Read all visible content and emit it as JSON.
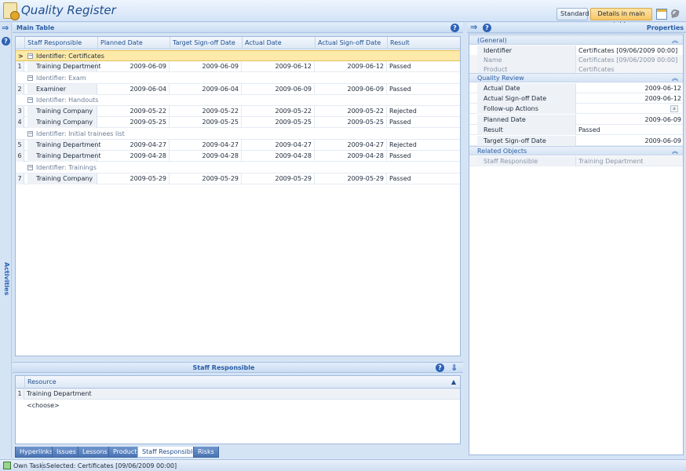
{
  "app": {
    "title": "Quality Register"
  },
  "toolbar": {
    "standard_label": "Standard",
    "details_label": "Details in main table"
  },
  "left_strip": {
    "label": "Activities"
  },
  "main": {
    "title": "Main Table",
    "columns": [
      "Staff Responsible",
      "Planned Date",
      "Target Sign-off Date",
      "Actual Date",
      "Actual Sign-off Date",
      "Result"
    ],
    "groups": [
      {
        "label": "Identifier: Certificates",
        "selected": true,
        "rows": [
          {
            "num": "1",
            "staff": "Training Department",
            "planned": "2009-06-09",
            "target": "2009-06-09",
            "actual": "2009-06-12",
            "actual_signoff": "2009-06-12",
            "result": "Passed"
          }
        ]
      },
      {
        "label": "Identifier: Exam",
        "rows": [
          {
            "num": "2",
            "staff": "Examiner",
            "planned": "2009-06-04",
            "target": "2009-06-04",
            "actual": "2009-06-09",
            "actual_signoff": "2009-06-09",
            "result": "Passed"
          }
        ]
      },
      {
        "label": "Identifier: Handouts",
        "rows": [
          {
            "num": "3",
            "staff": "Training Company",
            "planned": "2009-05-22",
            "target": "2009-05-22",
            "actual": "2009-05-22",
            "actual_signoff": "2009-05-22",
            "result": "Rejected"
          },
          {
            "num": "4",
            "staff": "Training Company",
            "planned": "2009-05-25",
            "target": "2009-05-25",
            "actual": "2009-05-25",
            "actual_signoff": "2009-05-25",
            "result": "Passed"
          }
        ]
      },
      {
        "label": "Identifier: Initial trainees list",
        "rows": [
          {
            "num": "5",
            "staff": "Training Department",
            "planned": "2009-04-27",
            "target": "2009-04-27",
            "actual": "2009-04-27",
            "actual_signoff": "2009-04-27",
            "result": "Rejected"
          },
          {
            "num": "6",
            "staff": "Training Department",
            "planned": "2009-04-28",
            "target": "2009-04-28",
            "actual": "2009-04-28",
            "actual_signoff": "2009-04-28",
            "result": "Passed"
          }
        ]
      },
      {
        "label": "Identifier: Trainings",
        "rows": [
          {
            "num": "7",
            "staff": "Training Company",
            "planned": "2009-05-29",
            "target": "2009-05-29",
            "actual": "2009-05-29",
            "actual_signoff": "2009-05-29",
            "result": "Passed"
          }
        ]
      }
    ]
  },
  "sub": {
    "title": "Staff Responsible",
    "column": "Resource",
    "row1_num": "1",
    "row1": "Training Department",
    "row2": "<choose>"
  },
  "tabs": [
    "Hyperlinks",
    "Issues",
    "Lessons",
    "Product",
    "Staff Responsible",
    "Risks"
  ],
  "active_tab": "Staff Responsible",
  "properties": {
    "title": "Properties",
    "general": {
      "label": "(General)",
      "identifier_label": "Identifier",
      "identifier_value": "Certificates [09/06/2009 00:00]",
      "name_label": "Name",
      "name_value": "Certificates [09/06/2009 00:00]",
      "product_label": "Product",
      "product_value": "Certificates"
    },
    "quality_review": {
      "label": "Quality Review",
      "actual_date_label": "Actual Date",
      "actual_date_value": "2009-06-12",
      "actual_signoff_label": "Actual Sign-off Date",
      "actual_signoff_value": "2009-06-12",
      "followup_label": "Follow-up Actions",
      "followup_value": "",
      "planned_label": "Planned Date",
      "planned_value": "2009-06-09",
      "result_label": "Result",
      "result_value": "Passed",
      "target_label": "Target Sign-off Date",
      "target_value": "2009-06-09"
    },
    "related": {
      "label": "Related Objects",
      "staff_label": "Staff Responsible",
      "staff_value": "Training Department"
    }
  },
  "status": {
    "own_tasks": "Own Tasks",
    "selected": "Selected: Certificates [09/06/2009 00:00]"
  }
}
